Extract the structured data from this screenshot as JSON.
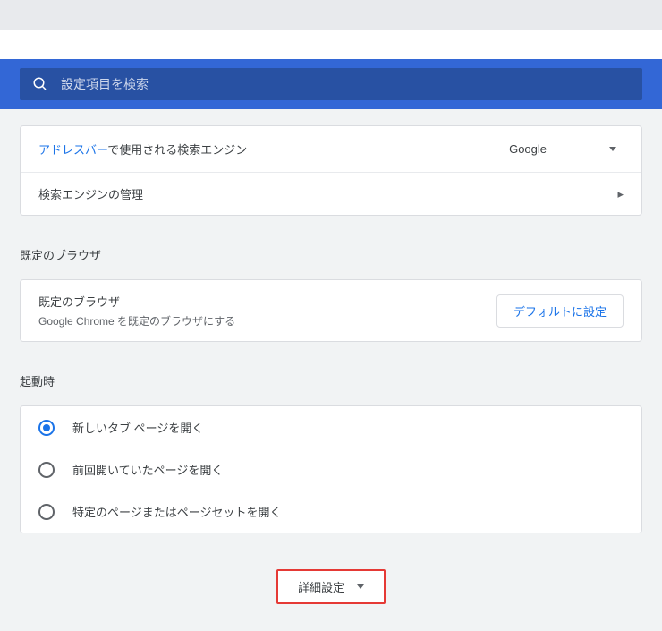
{
  "search": {
    "placeholder": "設定項目を検索"
  },
  "engine": {
    "label_prefix_link": "アドレスバー",
    "label_suffix": "で使用される検索エンジン",
    "selected": "Google",
    "manage_label": "検索エンジンの管理"
  },
  "default_browser": {
    "section_title": "既定のブラウザ",
    "row_title": "既定のブラウザ",
    "row_sub": "Google Chrome を既定のブラウザにする",
    "button": "デフォルトに設定"
  },
  "startup": {
    "section_title": "起動時",
    "options": [
      "新しいタブ ページを開く",
      "前回開いていたページを開く",
      "特定のページまたはページセットを開く"
    ],
    "selected_index": 0
  },
  "advanced": {
    "label": "詳細設定"
  }
}
